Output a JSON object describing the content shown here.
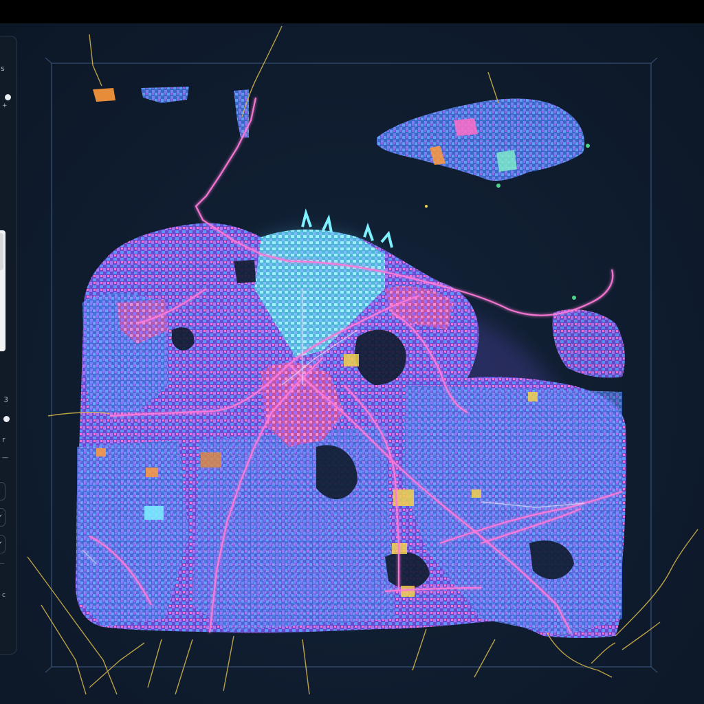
{
  "panel": {
    "label_top": "s",
    "label_plus": "+",
    "label_three": "3",
    "label_r": "r",
    "label_dash": "—",
    "check_1": "✓",
    "check_2": "✓",
    "label_c": "c"
  },
  "colors": {
    "background": "#0f1c2e",
    "building_blue": "#5aa0ff",
    "building_violet": "#8b6bff",
    "building_pink": "#ff6ec7",
    "building_cyan": "#7ef0ff",
    "building_yellow": "#f2d24a",
    "building_orange": "#ff9a3c",
    "building_green": "#4fd38a",
    "road_gold": "#d8b84a",
    "road_pink": "#ff7ad9",
    "frame": "#2f4666"
  },
  "map": {
    "layers": [
      "buildings",
      "roads",
      "parks"
    ],
    "frame_shown": true
  }
}
